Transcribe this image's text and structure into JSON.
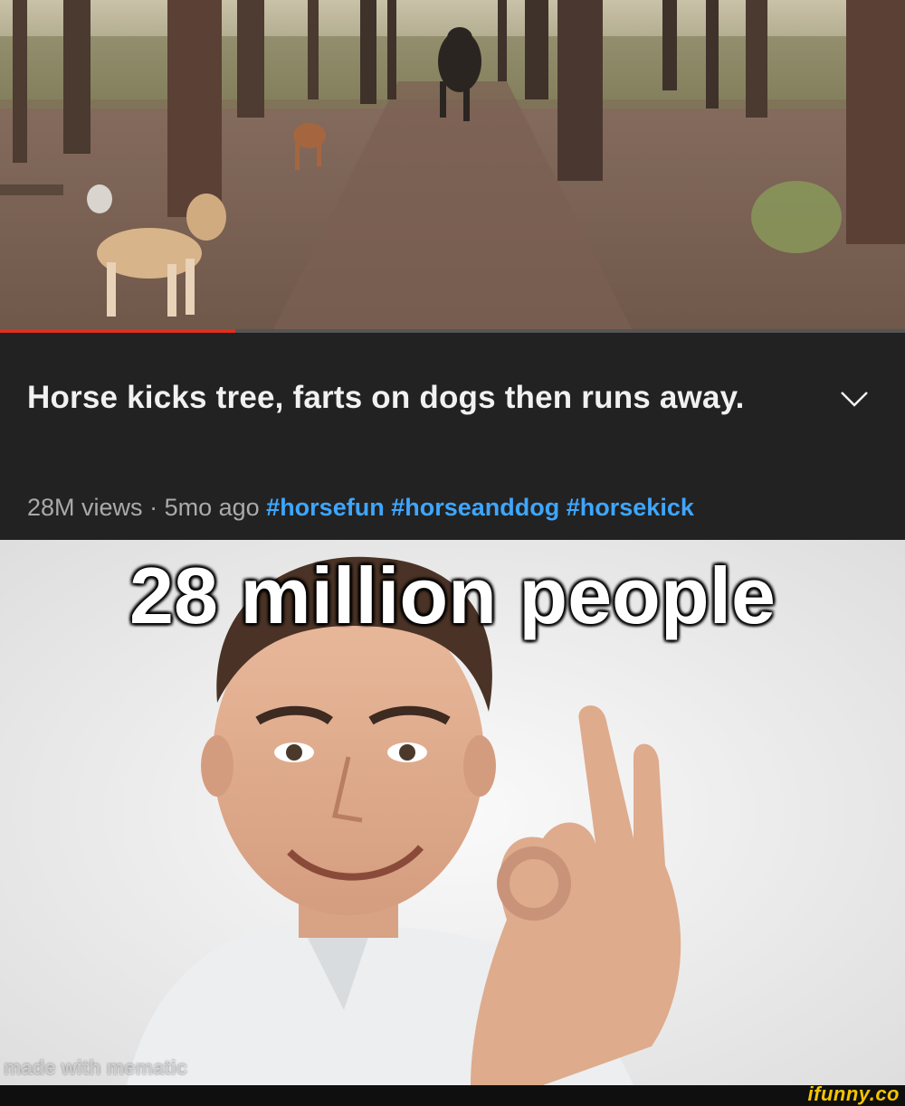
{
  "video": {
    "progress": 0.26,
    "progress_color": "#e0301e"
  },
  "video_info": {
    "title": "Horse kicks tree, farts on dogs then runs away.",
    "expand_icon": "chevron-down-icon",
    "views": "28M views",
    "separator": "·",
    "age": "5mo ago",
    "hashtags": [
      "#horsefun",
      "#horseanddog",
      "#horsekick"
    ],
    "hashtag_color": "#3ea6ff"
  },
  "meme": {
    "caption": "28 million people",
    "watermark": "made with mematic"
  },
  "footer": {
    "logo_text": "ifunny.co"
  }
}
